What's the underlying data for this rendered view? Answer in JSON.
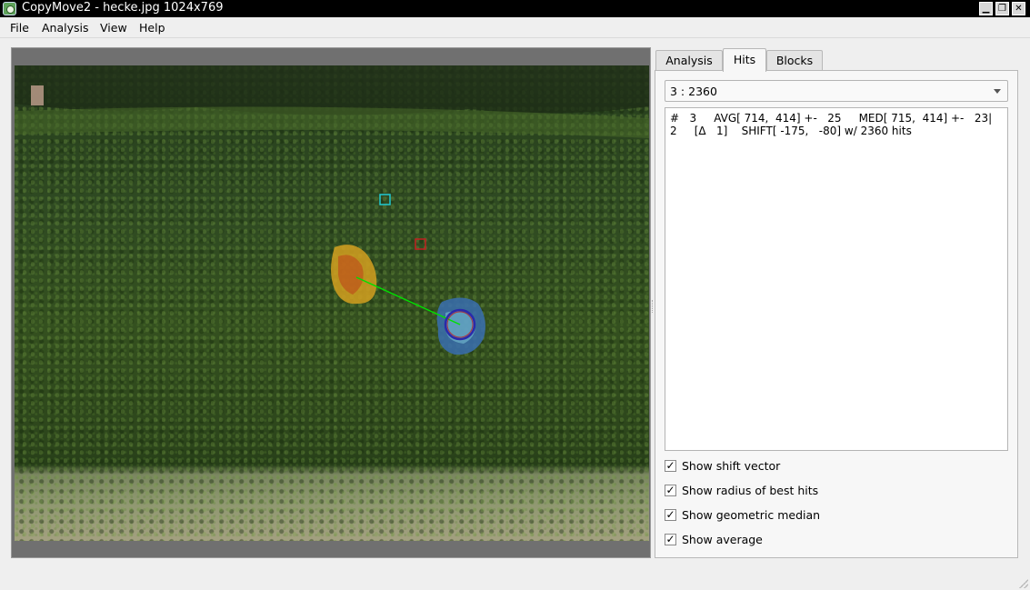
{
  "window": {
    "title": "CopyMove2 - hecke.jpg 1024x769",
    "minimize": "▁",
    "restore": "❐",
    "close": "✕"
  },
  "menu": [
    "File",
    "Analysis",
    "View",
    "Help"
  ],
  "tabs": [
    "Analysis",
    "Hits",
    "Blocks"
  ],
  "active_tab": "Hits",
  "hits": {
    "selected": "3 : 2360",
    "text_line1": "#   3     AVG[ 714,  414] +-   25     MED[ 715,  414] +-   23|",
    "text_line2": "2     [Δ   1]    SHIFT[ -175,   -80] w/ 2360 hits"
  },
  "options": [
    {
      "label": "Show shift vector",
      "checked": true
    },
    {
      "label": "Show radius of best hits",
      "checked": true
    },
    {
      "label": "Show geometric median",
      "checked": true
    },
    {
      "label": "Show average",
      "checked": true
    }
  ],
  "check_mark": "✓",
  "colors": {
    "source_region": "#d4a020",
    "target_region": "#3a6fb0",
    "shift_vector": "#00e000",
    "median_marker": "#c02020",
    "average_marker": "#20c8d0",
    "radius_circle": "#2a2aaa"
  },
  "icons": {
    "app": "copymove-app-icon",
    "dropdown": "chevron-down-icon"
  }
}
